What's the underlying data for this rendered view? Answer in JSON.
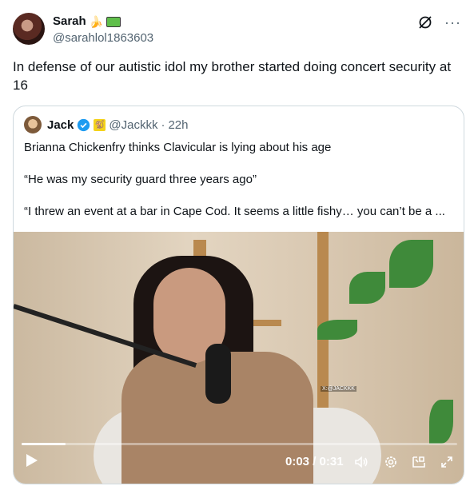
{
  "tweet": {
    "display_name": "Sarah",
    "name_emojis": [
      "🍌",
      "keyboard"
    ],
    "handle": "@sarahlol1863603",
    "text": "In defense of our autistic idol my brother started doing concert security at 16"
  },
  "quote": {
    "display_name": "Jack",
    "verified": true,
    "badge": "🐒",
    "handle": "@Jackkk",
    "dot": "·",
    "time": "22h",
    "lines": [
      "Brianna Chickenfry thinks Clavicular is lying about his age",
      "“He was my security guard three years ago”",
      "“I threw an event at a bar in Cape Cod. It seems a little fishy… you can’t be a ..."
    ]
  },
  "video": {
    "watermark": "X:@JACKKK",
    "time_display": "0:03 / 0:31",
    "progress": 0.1
  },
  "icons": {
    "grok": "grok-icon",
    "more": "more-icon",
    "play": "play-icon",
    "volume": "volume-icon",
    "settings": "gear-icon",
    "pip": "pip-icon",
    "fullscreen": "fullscreen-icon"
  },
  "colors": {
    "verified_blue": "#1d9bf0",
    "secondary_text": "#536471",
    "border": "#cfd9de"
  }
}
